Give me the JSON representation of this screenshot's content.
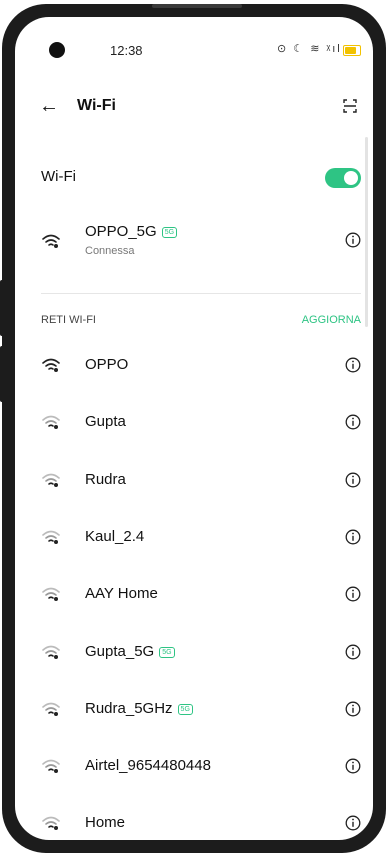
{
  "status": {
    "time": "12:38",
    "icons": "⊙ ☾ ≋ ᵡıl"
  },
  "header": {
    "title": "Wi-Fi"
  },
  "wifi_switch": {
    "label": "Wi-Fi",
    "on": true
  },
  "connected": {
    "name": "OPPO_5G",
    "badge": "5G",
    "status": "Connessa"
  },
  "networks_section": {
    "title": "RETI WI-FI",
    "refresh": "AGGIORNA"
  },
  "networks": [
    {
      "name": "OPPO",
      "badge": "",
      "strength": "strong"
    },
    {
      "name": "Gupta",
      "badge": "",
      "strength": "weak"
    },
    {
      "name": "Rudra",
      "badge": "",
      "strength": "weak"
    },
    {
      "name": "Kaul_2.4",
      "badge": "",
      "strength": "weak"
    },
    {
      "name": "AAY Home",
      "badge": "",
      "strength": "weak"
    },
    {
      "name": "Gupta_5G",
      "badge": "5G",
      "strength": "weak"
    },
    {
      "name": "Rudra_5GHz",
      "badge": "5G",
      "strength": "weak"
    },
    {
      "name": "Airtel_9654480448",
      "badge": "",
      "strength": "weak"
    },
    {
      "name": "Home",
      "badge": "",
      "strength": "weak"
    }
  ],
  "colors": {
    "accent": "#2ec484",
    "battery": "#f2c200"
  }
}
